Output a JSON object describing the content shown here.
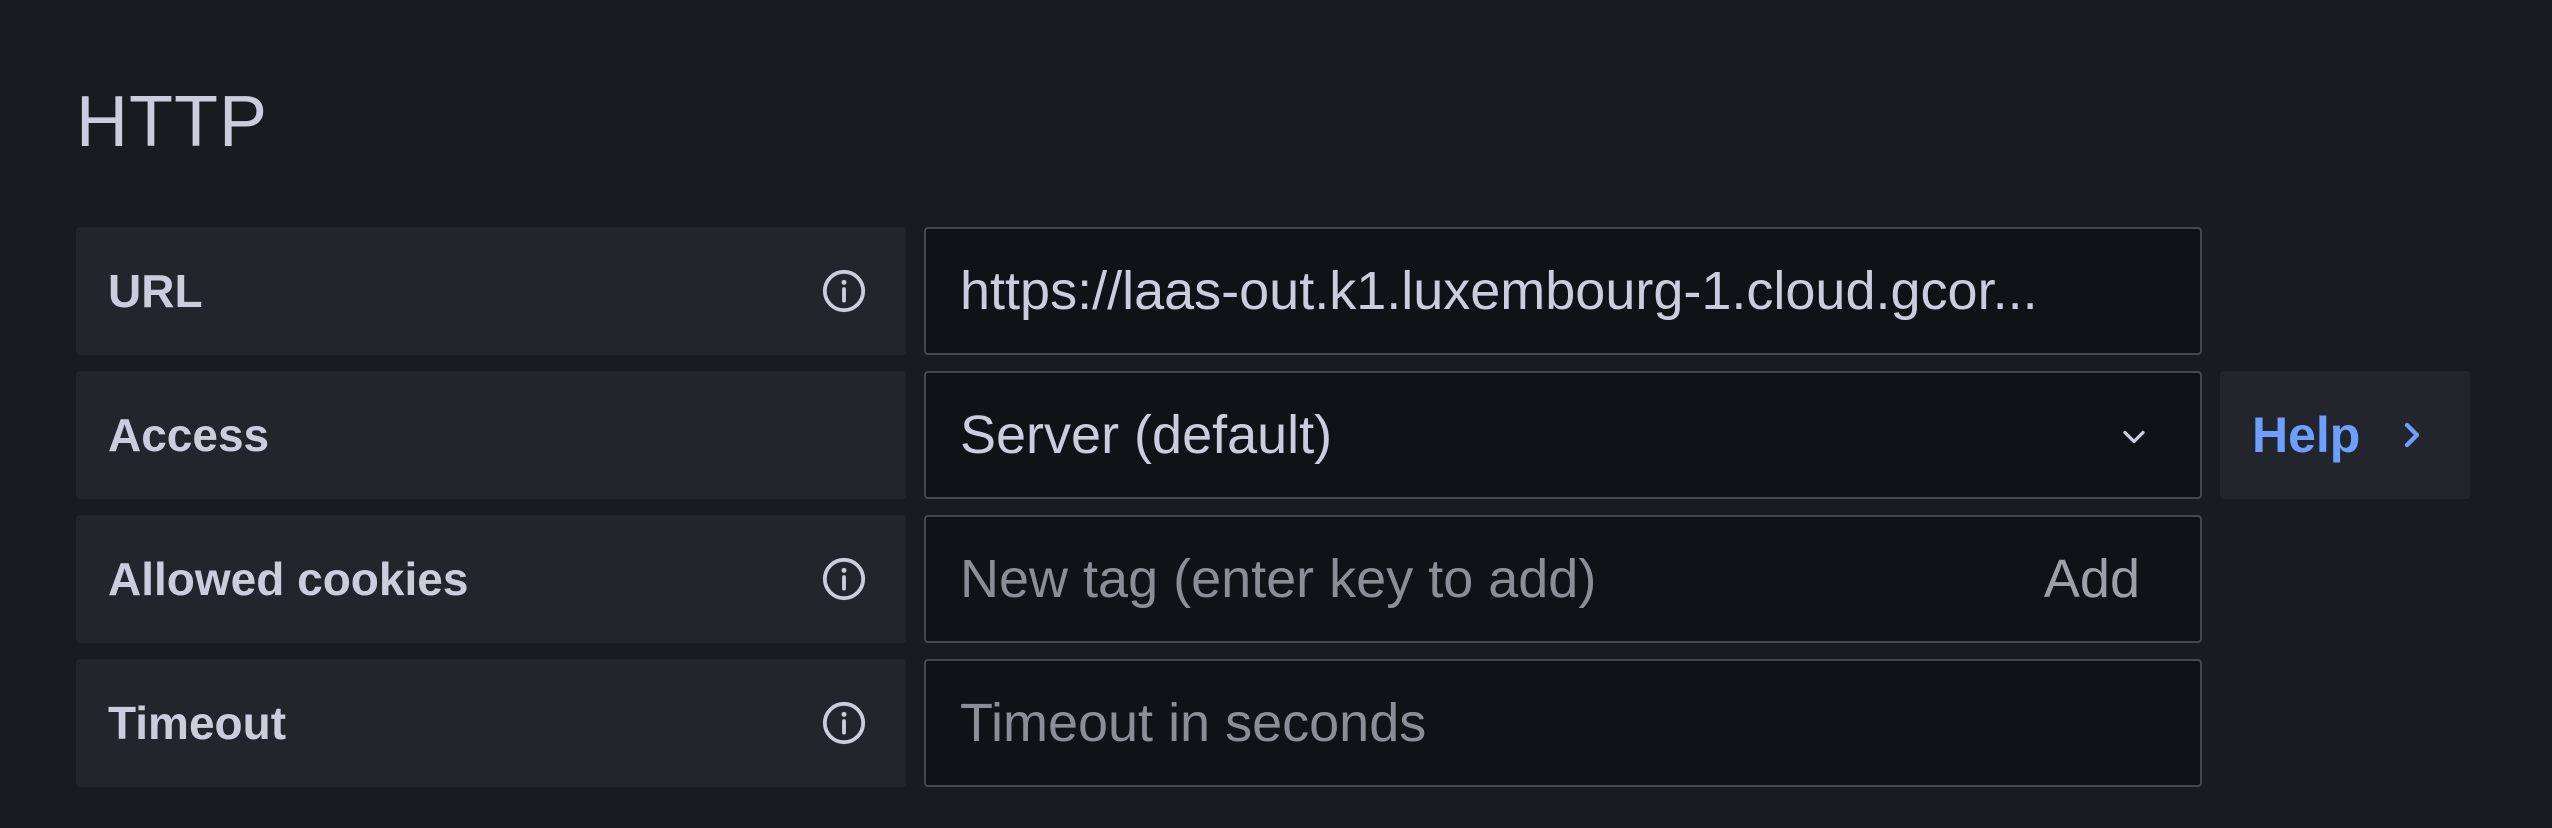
{
  "section": {
    "title": "HTTP"
  },
  "fields": {
    "url": {
      "label": "URL",
      "value": "https://laas-out.k1.luxembourg-1.cloud.gcor...",
      "info_icon": "info-circle-icon"
    },
    "access": {
      "label": "Access",
      "selected": "Server (default)",
      "dropdown_icon": "chevron-down-icon",
      "help_label": "Help",
      "help_icon": "chevron-right-icon"
    },
    "allowed_cookies": {
      "label": "Allowed cookies",
      "placeholder": "New tag (enter key to add)",
      "add_label": "Add",
      "info_icon": "info-circle-icon"
    },
    "timeout": {
      "label": "Timeout",
      "placeholder": "Timeout in seconds",
      "info_icon": "info-circle-icon"
    }
  },
  "colors": {
    "background": "#1a1b20",
    "label_bg": "#22252b",
    "input_bg": "#111217",
    "input_border": "#45474e",
    "text": "#ccccdc",
    "placeholder": "#8d8d97",
    "link": "#6e9fff"
  }
}
